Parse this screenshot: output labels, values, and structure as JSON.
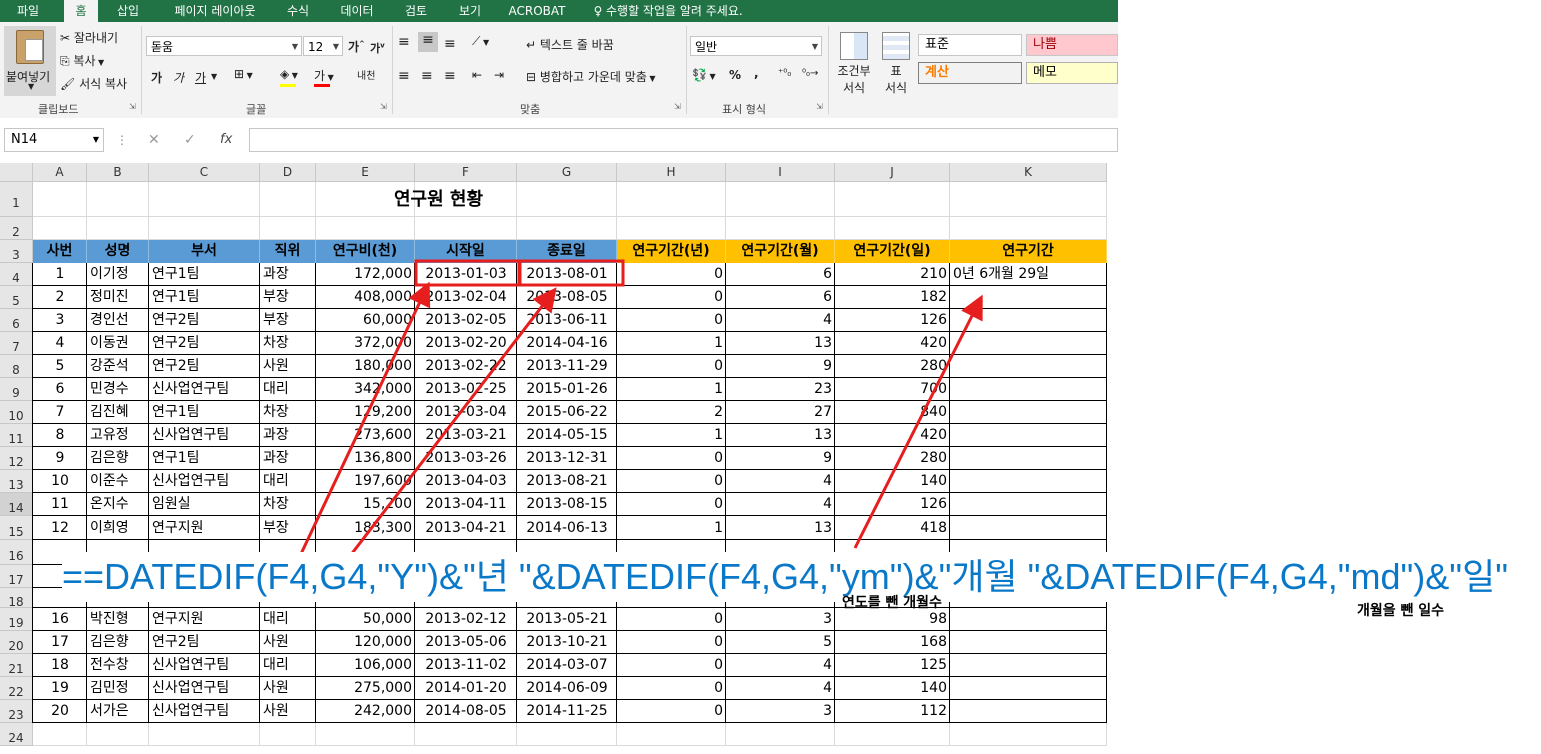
{
  "menu": {
    "tabs": [
      "파일",
      "홈",
      "삽입",
      "페이지 레이아웃",
      "수식",
      "데이터",
      "검토",
      "보기",
      "ACROBAT"
    ],
    "tell_me": "수행할 작업을 알려 주세요.",
    "active_tab": "홈"
  },
  "ribbon": {
    "clipboard": {
      "paste": "붙여넣기",
      "cut": "잘라내기",
      "copy": "복사",
      "format_painter": "서식 복사",
      "label": "클립보드"
    },
    "font": {
      "name": "돋움",
      "size": "12",
      "bold": "가",
      "italic": "가",
      "underline": "가",
      "label": "글꼴",
      "font_color_glyph": "가",
      "phonetic": "내천"
    },
    "alignment": {
      "wrap": "텍스트 줄 바꿈",
      "merge": "병합하고 가운데 맞춤",
      "label": "맞춤"
    },
    "number": {
      "format": "일반",
      "percent": "%",
      "comma": ",",
      "label": "표시 형식"
    },
    "styles": {
      "conditional": "조건부\n서식",
      "table": "표\n서식",
      "conditional_l1": "조건부",
      "conditional_l2": "서식",
      "table_l1": "표",
      "table_l2": "서식",
      "normal": "표준",
      "bad": "나쁨",
      "calc": "계산",
      "memo": "메모"
    }
  },
  "formula_bar": {
    "name_box": "N14",
    "cancel": "✕",
    "enter": "✓",
    "fx": "fx",
    "content": ""
  },
  "columns": [
    "A",
    "B",
    "C",
    "D",
    "E",
    "F",
    "G",
    "H",
    "I",
    "J",
    "K"
  ],
  "sheet": {
    "title": "연구원 현황",
    "headers": [
      "사번",
      "성명",
      "부서",
      "직위",
      "연구비(천)",
      "시작일",
      "종료일",
      "연구기간(년)",
      "연구기간(월)",
      "연구기간(일)",
      "연구기간"
    ],
    "rows": [
      [
        "1",
        "이기정",
        "연구1팀",
        "과장",
        "172,000",
        "2013-01-03",
        "2013-08-01",
        "0",
        "6",
        "210",
        "0년 6개월 29일"
      ],
      [
        "2",
        "정미진",
        "연구1팀",
        "부장",
        "408,000",
        "2013-02-04",
        "2013-08-05",
        "0",
        "6",
        "182",
        ""
      ],
      [
        "3",
        "경인선",
        "연구2팀",
        "부장",
        "60,000",
        "2013-02-05",
        "2013-06-11",
        "0",
        "4",
        "126",
        ""
      ],
      [
        "4",
        "이동권",
        "연구2팀",
        "차장",
        "372,000",
        "2013-02-20",
        "2014-04-16",
        "1",
        "13",
        "420",
        ""
      ],
      [
        "5",
        "강준석",
        "연구2팀",
        "사원",
        "180,000",
        "2013-02-22",
        "2013-11-29",
        "0",
        "9",
        "280",
        ""
      ],
      [
        "6",
        "민경수",
        "신사업연구팀",
        "대리",
        "342,000",
        "2013-02-25",
        "2015-01-26",
        "1",
        "23",
        "700",
        ""
      ],
      [
        "7",
        "김진혜",
        "연구1팀",
        "차장",
        "129,200",
        "2013-03-04",
        "2015-06-22",
        "2",
        "27",
        "840",
        ""
      ],
      [
        "8",
        "고유정",
        "신사업연구팀",
        "과장",
        "273,600",
        "2013-03-21",
        "2014-05-15",
        "1",
        "13",
        "420",
        ""
      ],
      [
        "9",
        "김은향",
        "연구1팀",
        "과장",
        "136,800",
        "2013-03-26",
        "2013-12-31",
        "0",
        "9",
        "280",
        ""
      ],
      [
        "10",
        "이준수",
        "신사업연구팀",
        "대리",
        "197,600",
        "2013-04-03",
        "2013-08-21",
        "0",
        "4",
        "140",
        ""
      ],
      [
        "11",
        "온지수",
        "임원실",
        "차장",
        "15,200",
        "2013-04-11",
        "2013-08-15",
        "0",
        "4",
        "126",
        ""
      ],
      [
        "12",
        "이희영",
        "연구지원",
        "부장",
        "183,300",
        "2013-04-21",
        "2014-06-13",
        "1",
        "13",
        "418",
        ""
      ],
      [
        "16",
        "박진형",
        "연구지원",
        "대리",
        "50,000",
        "2013-02-12",
        "2013-05-21",
        "0",
        "3",
        "98",
        ""
      ],
      [
        "17",
        "김은향",
        "연구2팀",
        "사원",
        "120,000",
        "2013-05-06",
        "2013-10-21",
        "0",
        "5",
        "168",
        ""
      ],
      [
        "18",
        "전수창",
        "신사업연구팀",
        "대리",
        "106,000",
        "2013-11-02",
        "2014-03-07",
        "0",
        "4",
        "125",
        ""
      ],
      [
        "19",
        "김민정",
        "신사업연구팀",
        "사원",
        "275,000",
        "2014-01-20",
        "2014-06-09",
        "0",
        "4",
        "140",
        ""
      ],
      [
        "20",
        "서가은",
        "신사업연구팀",
        "사원",
        "242,000",
        "2014-08-05",
        "2014-11-25",
        "0",
        "3",
        "112",
        ""
      ]
    ],
    "row_numbers": [
      "1",
      "2",
      "3",
      "4",
      "5",
      "6",
      "7",
      "8",
      "9",
      "10",
      "11",
      "12",
      "13",
      "14",
      "15",
      "16",
      "17",
      "18",
      "19",
      "20",
      "21",
      "22",
      "23",
      "24"
    ]
  },
  "annotation": {
    "formula": "==DATEDIF(F4,G4,\"Y\")&\"년 \"&DATEDIF(F4,G4,\"ym\")&\"개월 \"&DATEDIF(F4,G4,\"md\")&\"일\"",
    "note_months": "연도를 뺀 개월수",
    "note_days": "개월을 뺀 일수"
  },
  "colors": {
    "excel_green": "#217346",
    "header_blue": "#5b9bd5",
    "header_orange": "#ffc000",
    "annotation_red": "#e61e1e",
    "formula_blue": "#0a78c8"
  }
}
